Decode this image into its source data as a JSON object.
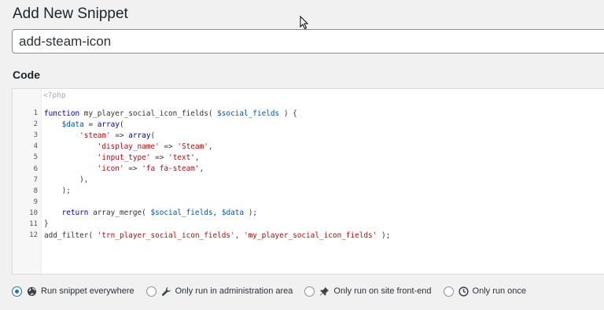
{
  "page_title": "Add New Snippet",
  "snippet_name": {
    "value": "add-steam-icon"
  },
  "code_label": "Code",
  "editor": {
    "php_open_tag": "<?php",
    "lines": [
      {
        "num": "1",
        "code": "function my_player_social_icon_fields( $social_fields ) {"
      },
      {
        "num": "2",
        "code": "    $data = array("
      },
      {
        "num": "3",
        "code": "        'steam' => array("
      },
      {
        "num": "4",
        "code": "            'display_name' => 'Steam',"
      },
      {
        "num": "5",
        "code": "            'input_type' => 'text',"
      },
      {
        "num": "6",
        "code": "            'icon' => 'fa fa-steam',"
      },
      {
        "num": "7",
        "code": "        ),"
      },
      {
        "num": "8",
        "code": "    );"
      },
      {
        "num": "9",
        "code": ""
      },
      {
        "num": "10",
        "code": "    return array_merge( $social_fields, $data );"
      },
      {
        "num": "11",
        "code": "}"
      },
      {
        "num": "12",
        "code": "add_filter( 'trn_player_social_icon_fields', 'my_player_social_icon_fields' );"
      }
    ]
  },
  "run_options": [
    {
      "label": "Run snippet everywhere",
      "icon": "globe-icon",
      "checked": true
    },
    {
      "label": "Only run in administration area",
      "icon": "wrench-icon",
      "checked": false
    },
    {
      "label": "Only run on site front-end",
      "icon": "pushpin-icon",
      "checked": false
    },
    {
      "label": "Only run once",
      "icon": "clock-icon",
      "checked": false
    }
  ],
  "colors": {
    "accent": "#2271b1",
    "keyword": "#0000aa",
    "string": "#aa1111",
    "variable": "#0055aa"
  }
}
